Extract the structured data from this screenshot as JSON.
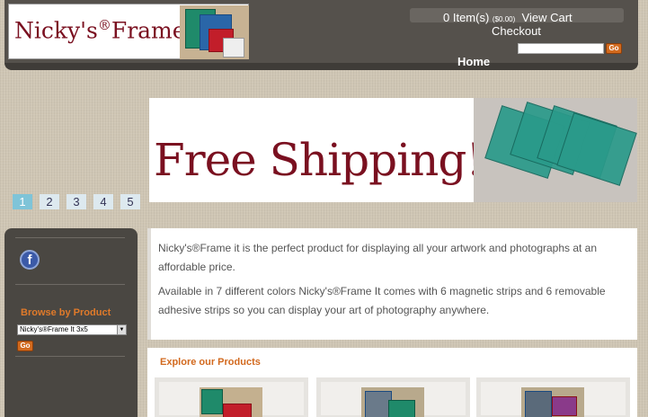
{
  "header": {
    "logo_text": "Nicky's",
    "logo_mark": "®",
    "logo_suffix": "Frame It",
    "cart_count": "0 Item(s)",
    "cart_total": "($0.00)",
    "view_cart": "View Cart",
    "checkout": "Checkout",
    "search_placeholder": "",
    "go_label": "Go",
    "nav": [
      "Home"
    ]
  },
  "banner": {
    "text": "Free Shipping!",
    "pager": [
      "1",
      "2",
      "3",
      "4",
      "5"
    ],
    "active_page": "1"
  },
  "sidebar": {
    "social_icon": "facebook-icon",
    "browse_title": "Browse by Product",
    "selected_product": "Nicky's®Frame It 3x5",
    "go_label": "Go"
  },
  "content": {
    "intro_1": "Nicky's®Frame it is the perfect product for displaying all your artwork and photographs at an affordable price.",
    "intro_2": "Available in 7 different colors Nicky's®Frame It comes with 6 magnetic strips and 6 removable adhesive strips so you can display your art of photography anywhere.",
    "explore_title": "Explore our Products"
  },
  "colors": {
    "brand_red": "#7a1020",
    "accent_orange": "#d26a1e",
    "header_gray": "#55514c"
  }
}
